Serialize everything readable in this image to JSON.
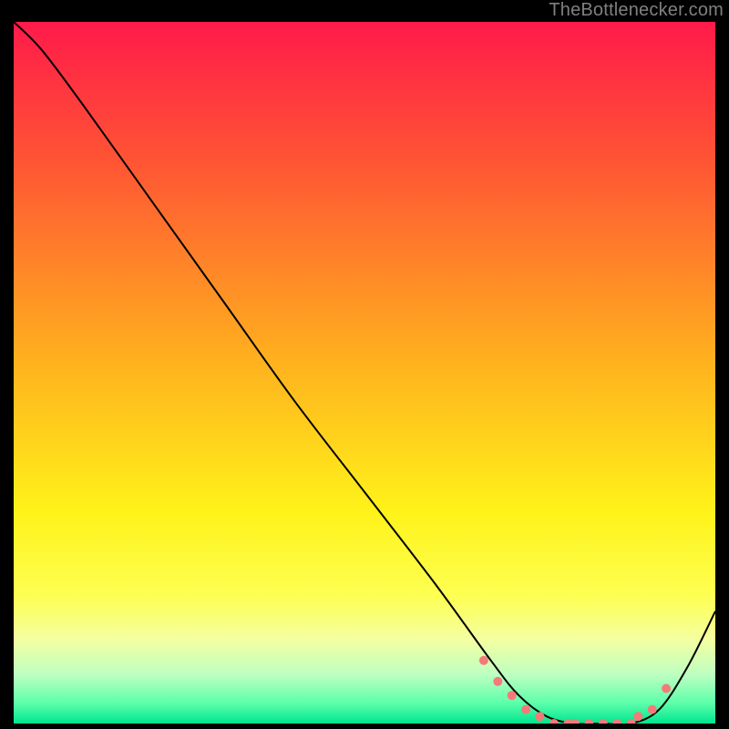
{
  "attribution": "TheBottlenecker.com",
  "chart_data": {
    "type": "line",
    "title": "",
    "xlabel": "",
    "ylabel": "",
    "xlim": [
      0,
      100
    ],
    "ylim": [
      0,
      100
    ],
    "grid": false,
    "legend": false,
    "gradient_stops": [
      {
        "offset": 0.0,
        "color": "#ff1a4a"
      },
      {
        "offset": 0.2,
        "color": "#ff5534"
      },
      {
        "offset": 0.48,
        "color": "#ffb01e"
      },
      {
        "offset": 0.7,
        "color": "#fff31a"
      },
      {
        "offset": 0.82,
        "color": "#fdff53"
      },
      {
        "offset": 0.88,
        "color": "#f4ffa1"
      },
      {
        "offset": 0.93,
        "color": "#beffc1"
      },
      {
        "offset": 0.97,
        "color": "#5fffab"
      },
      {
        "offset": 1.0,
        "color": "#00e58f"
      }
    ],
    "series": [
      {
        "name": "curve",
        "color": "#000000",
        "x": [
          0,
          4,
          10,
          20,
          30,
          40,
          50,
          60,
          68,
          72,
          76,
          80,
          84,
          88,
          92,
          96,
          100
        ],
        "y": [
          100,
          96,
          88,
          74,
          60,
          46,
          33,
          20,
          9,
          4,
          1,
          0,
          0,
          0,
          2,
          8,
          16
        ]
      }
    ],
    "markers": {
      "name": "dots",
      "color": "#f47a7a",
      "radius": 5,
      "x": [
        67,
        69,
        71,
        73,
        75,
        77,
        79,
        80,
        82,
        84,
        86,
        88,
        89,
        91,
        93
      ],
      "y": [
        9,
        6,
        4,
        2,
        1,
        0,
        0,
        0,
        0,
        0,
        0,
        0,
        1,
        2,
        5
      ]
    }
  }
}
